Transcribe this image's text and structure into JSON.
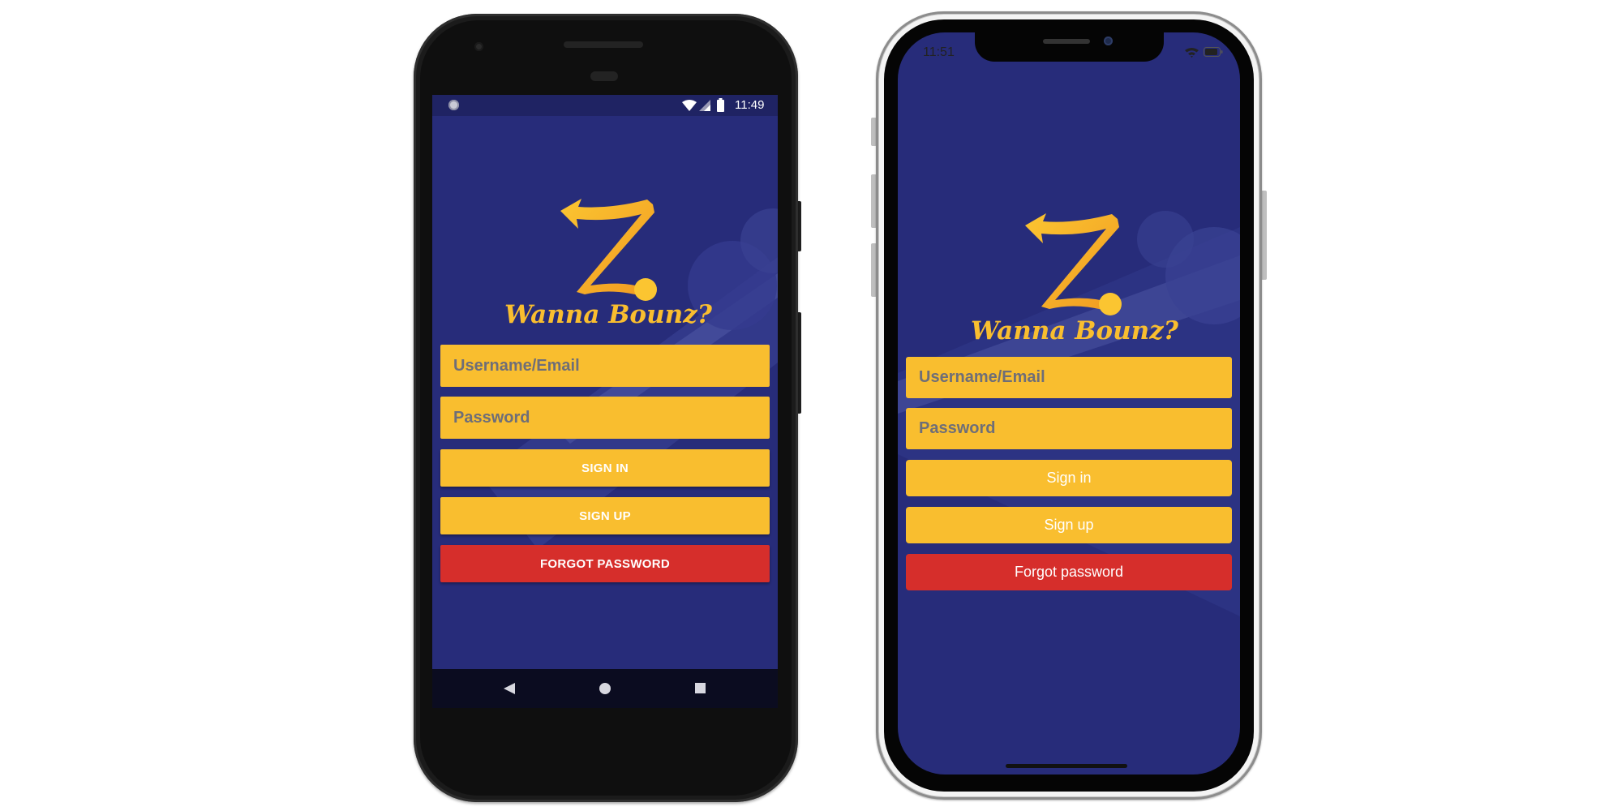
{
  "android": {
    "status_time": "11:49",
    "app_name": "Wanna Bounz?",
    "username_placeholder": "Username/Email",
    "password_placeholder": "Password",
    "sign_in_label": "SIGN IN",
    "sign_up_label": "SIGN UP",
    "forgot_label": "FORGOT PASSWORD"
  },
  "ios": {
    "status_time": "11:51",
    "app_name": "Wanna Bounz?",
    "username_placeholder": "Username/Email",
    "password_placeholder": "Password",
    "sign_in_label": "Sign in",
    "sign_up_label": "Sign up",
    "forgot_label": "Forgot password"
  },
  "colors": {
    "background": "#272c7a",
    "accent": "#f9be2f",
    "danger": "#d62e2b"
  },
  "icons": [
    "wifi-icon",
    "signal-icon",
    "battery-icon",
    "back-icon",
    "home-icon",
    "recents-icon",
    "logo-icon"
  ]
}
